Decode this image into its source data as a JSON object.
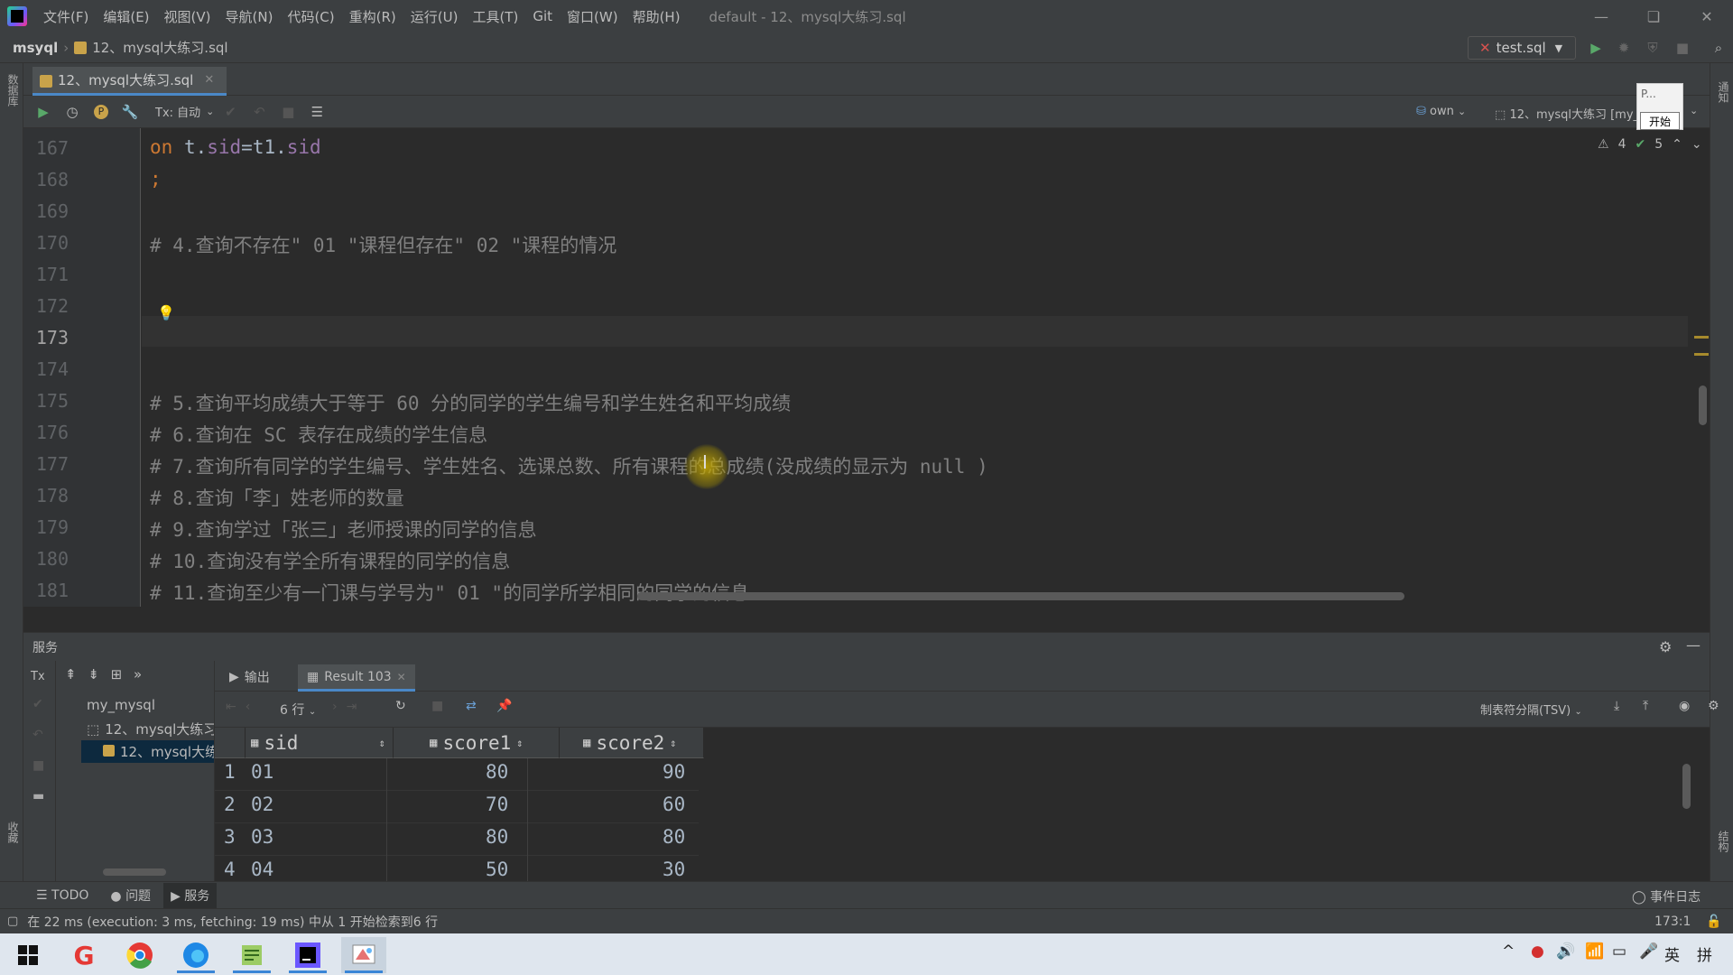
{
  "titlebar": {
    "menus": [
      "文件(F)",
      "编辑(E)",
      "视图(V)",
      "导航(N)",
      "代码(C)",
      "重构(R)",
      "运行(U)",
      "工具(T)",
      "Git",
      "窗口(W)",
      "帮助(H)"
    ],
    "title": "default - 12、mysql大练习.sql"
  },
  "navbar": {
    "project": "msyql",
    "file": "12、mysql大练习.sql",
    "run_config": "test.sql"
  },
  "editor_tab": {
    "label": "12、mysql大练习.sql"
  },
  "editor_toolbar": {
    "tx_mode": "Tx: 自动",
    "schema": "own",
    "console": "12、mysql大练习 [my_"
  },
  "popup": {
    "text": "P...",
    "button": "开始"
  },
  "inspections": {
    "warnings": "4",
    "ok": "5"
  },
  "editor": {
    "lines": [
      {
        "num": "167",
        "text": ""
      },
      {
        "num": "168",
        "text": ";"
      },
      {
        "num": "169",
        "text": ""
      },
      {
        "num": "170",
        "text": "# 4.查询不存在\" 01 \"课程但存在\" 02 \"课程的情况"
      },
      {
        "num": "171",
        "text": ""
      },
      {
        "num": "172",
        "text": ""
      },
      {
        "num": "173",
        "text": ""
      },
      {
        "num": "174",
        "text": ""
      },
      {
        "num": "175",
        "text": "# 5.查询平均成绩大于等于 60 分的同学的学生编号和学生姓名和平均成绩"
      },
      {
        "num": "176",
        "text": "# 6.查询在 SC 表存在成绩的学生信息"
      },
      {
        "num": "177",
        "text": "# 7.查询所有同学的学生编号、学生姓名、选课总数、所有课程的总成绩(没成绩的显示为 null )"
      },
      {
        "num": "178",
        "text": "# 8.查询「李」姓老师的数量"
      },
      {
        "num": "179",
        "text": "# 9.查询学过「张三」老师授课的同学的信息"
      },
      {
        "num": "180",
        "text": "# 10.查询没有学全所有课程的同学的信息"
      },
      {
        "num": "181",
        "text": "# 11.查询至少有一门课与学号为\" 01 \"的同学所学相同的同学的信息"
      }
    ],
    "line167": {
      "kw": "on",
      "a": " t.",
      "f1": "sid",
      "eq": "=t1.",
      "f2": "sid"
    }
  },
  "services": {
    "title": "服务",
    "tree": [
      "my_mysql",
      "12、mysql大练习",
      "12、mysql大练"
    ],
    "tabs": {
      "output": "输出",
      "result": "Result 103"
    },
    "rows_label": "6 行",
    "export_format": "制表符分隔(TSV)",
    "columns": [
      "sid",
      "score1",
      "score2"
    ],
    "rows": [
      {
        "idx": "1",
        "sid": "01",
        "score1": "80",
        "score2": "90"
      },
      {
        "idx": "2",
        "sid": "02",
        "score1": "70",
        "score2": "60"
      },
      {
        "idx": "3",
        "sid": "03",
        "score1": "80",
        "score2": "80"
      },
      {
        "idx": "4",
        "sid": "04",
        "score1": "50",
        "score2": "30"
      }
    ]
  },
  "bottom_tabs": {
    "todo": "TODO",
    "problems": "问题",
    "services": "服务",
    "event_log": "事件日志"
  },
  "statusbar": {
    "message": "在 22 ms (execution: 3 ms, fetching: 19 ms) 中从 1 开始检索到6 行",
    "position": "173:1"
  },
  "side_labels": {
    "database": "数据库",
    "favorites": "收藏",
    "structure": "结构",
    "notifications": "通知"
  },
  "taskbar": {
    "ime1": "英",
    "ime2": "拼"
  }
}
